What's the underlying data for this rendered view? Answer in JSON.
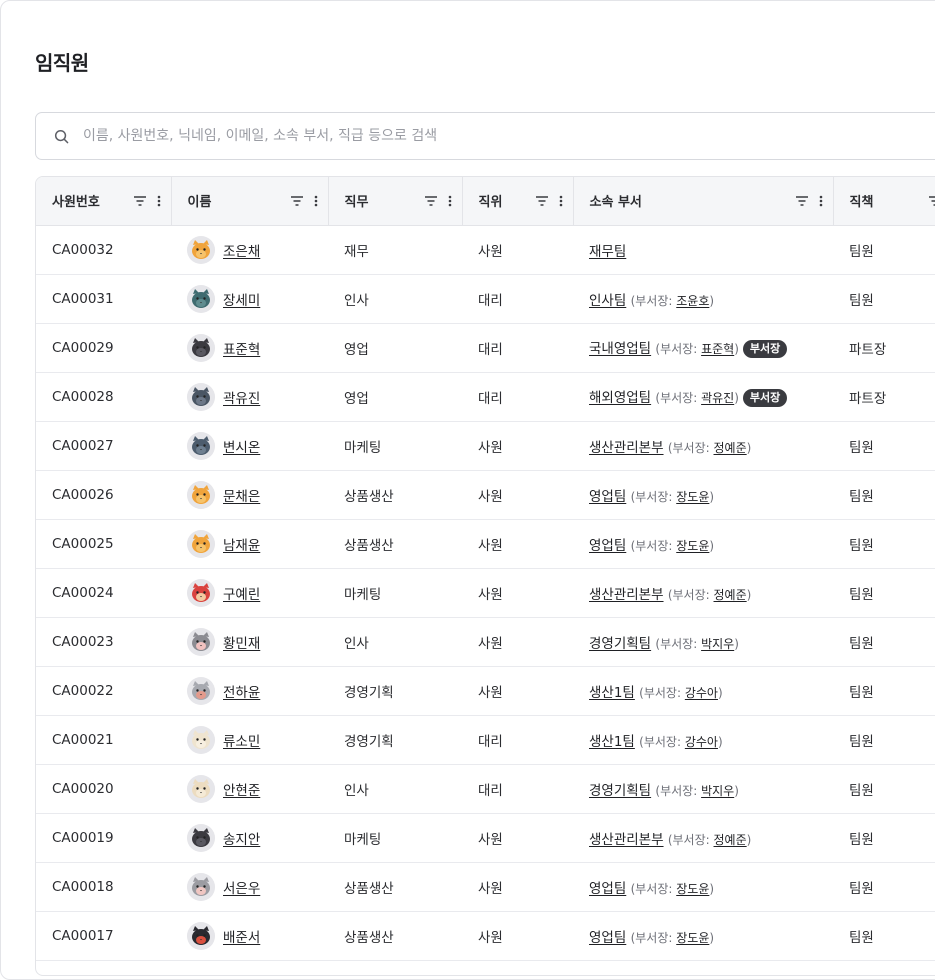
{
  "page": {
    "title": "임직원"
  },
  "search": {
    "placeholder": "이름, 사원번호, 닉네임, 이메일, 소속 부서, 직급 등으로 검색"
  },
  "table": {
    "columns": [
      "사원번호",
      "이름",
      "직무",
      "직위",
      "소속 부서",
      "직책"
    ],
    "head_prefix": "부서장:",
    "rows": [
      {
        "id": "CA00032",
        "name": "조은채",
        "avatar": {
          "fur": "#f0a43c",
          "face": "#f6c36b"
        },
        "job": "재무",
        "position": "사원",
        "dept": "재무팀",
        "head": "",
        "is_head": false,
        "role": "팀원"
      },
      {
        "id": "CA00031",
        "name": "장세미",
        "avatar": {
          "fur": "#3f6b70",
          "face": "#5f8c8f"
        },
        "job": "인사",
        "position": "대리",
        "dept": "인사팀",
        "head": "조윤호",
        "is_head": false,
        "role": "팀원"
      },
      {
        "id": "CA00029",
        "name": "표준혁",
        "avatar": {
          "fur": "#3b3a40",
          "face": "#5a5961"
        },
        "job": "영업",
        "position": "대리",
        "dept": "국내영업팀",
        "head": "표준혁",
        "is_head": true,
        "badge": "부서장",
        "role": "파트장"
      },
      {
        "id": "CA00028",
        "name": "곽유진",
        "avatar": {
          "fur": "#4a5664",
          "face": "#6d7888"
        },
        "job": "영업",
        "position": "대리",
        "dept": "해외영업팀",
        "head": "곽유진",
        "is_head": true,
        "badge": "부서장",
        "role": "파트장"
      },
      {
        "id": "CA00027",
        "name": "변시온",
        "avatar": {
          "fur": "#4d5d6e",
          "face": "#6e7f90"
        },
        "job": "마케팅",
        "position": "사원",
        "dept": "생산관리본부",
        "head": "정예준",
        "is_head": false,
        "role": "팀원"
      },
      {
        "id": "CA00026",
        "name": "문채은",
        "avatar": {
          "fur": "#f0a43c",
          "face": "#f6c36b"
        },
        "job": "상품생산",
        "position": "사원",
        "dept": "영업팀",
        "head": "장도윤",
        "is_head": false,
        "role": "팀원"
      },
      {
        "id": "CA00025",
        "name": "남재윤",
        "avatar": {
          "fur": "#f0a43c",
          "face": "#f6c36b"
        },
        "job": "상품생산",
        "position": "사원",
        "dept": "영업팀",
        "head": "장도윤",
        "is_head": false,
        "role": "팀원"
      },
      {
        "id": "CA00024",
        "name": "구예린",
        "avatar": {
          "fur": "#d9433f",
          "face": "#f2c9a0"
        },
        "job": "마케팅",
        "position": "사원",
        "dept": "생산관리본부",
        "head": "정예준",
        "is_head": false,
        "role": "팀원"
      },
      {
        "id": "CA00023",
        "name": "황민재",
        "avatar": {
          "fur": "#8c8c92",
          "face": "#f1c2c0"
        },
        "job": "인사",
        "position": "사원",
        "dept": "경영기획팀",
        "head": "박지우",
        "is_head": false,
        "role": "팀원"
      },
      {
        "id": "CA00022",
        "name": "전하윤",
        "avatar": {
          "fur": "#a7a9b0",
          "face": "#e39a8c"
        },
        "job": "경영기획",
        "position": "사원",
        "dept": "생산1팀",
        "head": "강수아",
        "is_head": false,
        "role": "팀원"
      },
      {
        "id": "CA00021",
        "name": "류소민",
        "avatar": {
          "fur": "#efe4cf",
          "face": "#f7efe0"
        },
        "job": "경영기획",
        "position": "대리",
        "dept": "생산1팀",
        "head": "강수아",
        "is_head": false,
        "role": "팀원"
      },
      {
        "id": "CA00020",
        "name": "안현준",
        "avatar": {
          "fur": "#ecdcc0",
          "face": "#f5ead6"
        },
        "job": "인사",
        "position": "대리",
        "dept": "경영기획팀",
        "head": "박지우",
        "is_head": false,
        "role": "팀원"
      },
      {
        "id": "CA00019",
        "name": "송지안",
        "avatar": {
          "fur": "#3b3a40",
          "face": "#5a5961"
        },
        "job": "마케팅",
        "position": "사원",
        "dept": "생산관리본부",
        "head": "정예준",
        "is_head": false,
        "role": "팀원"
      },
      {
        "id": "CA00018",
        "name": "서은우",
        "avatar": {
          "fur": "#9c9ca2",
          "face": "#f0c6c2"
        },
        "job": "상품생산",
        "position": "사원",
        "dept": "영업팀",
        "head": "장도윤",
        "is_head": false,
        "role": "팀원"
      },
      {
        "id": "CA00017",
        "name": "배준서",
        "avatar": {
          "fur": "#2a2a30",
          "face": "#d9503f"
        },
        "job": "상품생산",
        "position": "사원",
        "dept": "영업팀",
        "head": "장도윤",
        "is_head": false,
        "role": "팀원"
      }
    ]
  }
}
